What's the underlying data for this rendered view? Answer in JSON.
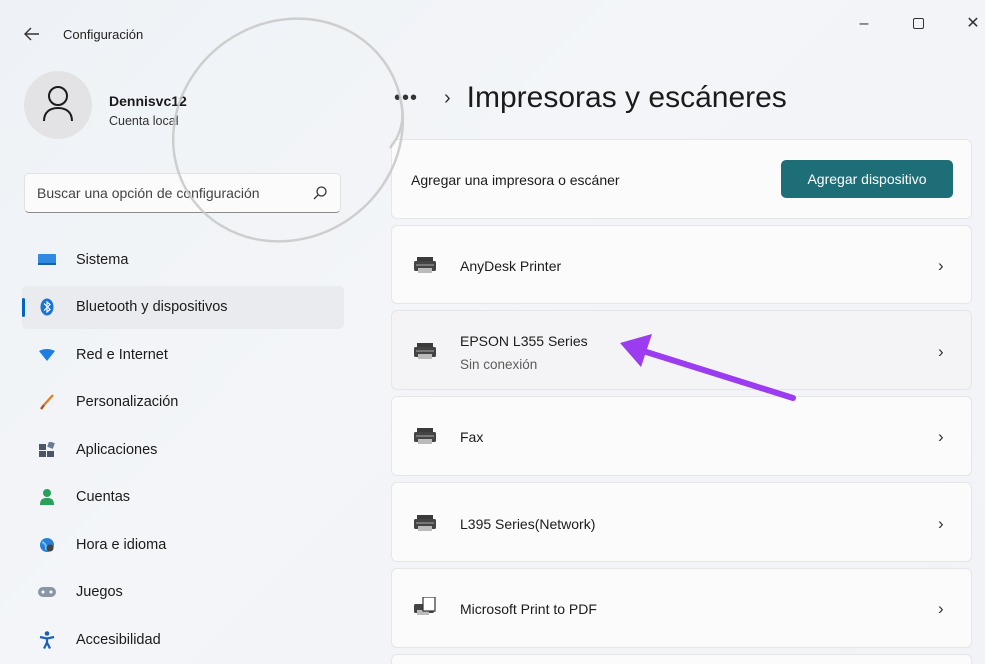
{
  "window": {
    "title": "Configuración",
    "back_icon": "back-arrow-icon",
    "controls": {
      "minimize": "–",
      "maximize": "",
      "close": "✕"
    }
  },
  "profile": {
    "name": "Dennisvc12",
    "account_type": "Cuenta local"
  },
  "search": {
    "placeholder": "Buscar una opción de configuración"
  },
  "sidebar": {
    "items": [
      {
        "label": "Sistema",
        "icon": "system-icon",
        "selected": false
      },
      {
        "label": "Bluetooth y dispositivos",
        "icon": "bluetooth-icon",
        "selected": true
      },
      {
        "label": "Red e Internet",
        "icon": "wifi-icon",
        "selected": false
      },
      {
        "label": "Personalización",
        "icon": "brush-icon",
        "selected": false
      },
      {
        "label": "Aplicaciones",
        "icon": "apps-icon",
        "selected": false
      },
      {
        "label": "Cuentas",
        "icon": "account-icon",
        "selected": false
      },
      {
        "label": "Hora e idioma",
        "icon": "globe-clock-icon",
        "selected": false
      },
      {
        "label": "Juegos",
        "icon": "gamepad-icon",
        "selected": false
      },
      {
        "label": "Accesibilidad",
        "icon": "accessibility-icon",
        "selected": false
      }
    ]
  },
  "main": {
    "breadcrumb_more": "•••",
    "breadcrumb_sep": "›",
    "title": "Impresoras y escáneres",
    "add_row": {
      "label": "Agregar una impresora o escáner",
      "button": "Agregar dispositivo"
    },
    "printers": [
      {
        "name": "AnyDesk Printer",
        "status": "",
        "icon": "printer-icon"
      },
      {
        "name": "EPSON L355 Series",
        "status": "Sin conexión",
        "icon": "printer-icon"
      },
      {
        "name": "Fax",
        "status": "",
        "icon": "printer-icon"
      },
      {
        "name": "L395 Series(Network)",
        "status": "",
        "icon": "printer-icon"
      },
      {
        "name": "Microsoft Print to PDF",
        "status": "",
        "icon": "pdf-printer-icon"
      }
    ],
    "chevron": "›"
  },
  "colors": {
    "accent": "#0067c0",
    "add_button": "#1e6e78",
    "annotation_arrow": "#9b3cf0"
  }
}
